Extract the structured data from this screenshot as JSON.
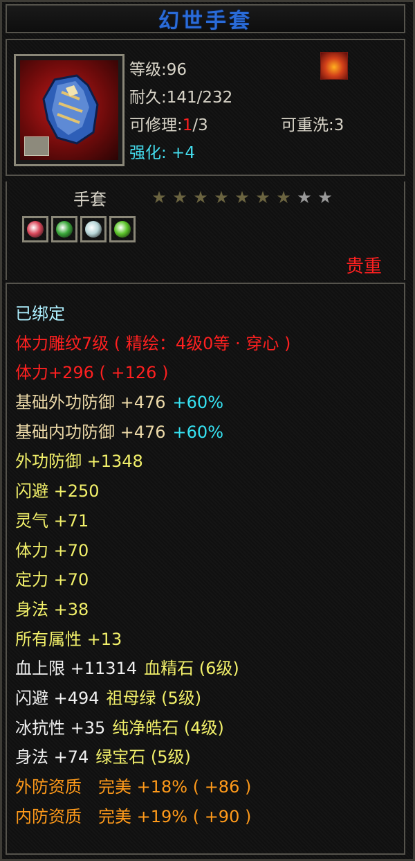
{
  "item": {
    "name": "幻世手套",
    "level_text": "等级:96",
    "durability_text": "耐久:141/232",
    "repair_prefix": "可修理:",
    "repair_current": "1",
    "repair_max": "/3",
    "rewash_text": "可重洗:3",
    "enhance_text": "强化: +4",
    "type": "手套",
    "stars_filled": 7,
    "stars_total": 9,
    "quality": "贵重"
  },
  "attributes": [
    {
      "text": "已绑定",
      "color": "#aef0ff"
    },
    {
      "text": "体力雕纹7级 ( 精绘：4级0等 · 穿心 )",
      "color": "#ff2020"
    },
    {
      "text": "体力+296 ( +126 )",
      "color": "#ff2020"
    },
    {
      "text": "基础外功防御 +476",
      "extra": "+60%",
      "color": "#ecd9a8",
      "extra_color": "#35e2f2"
    },
    {
      "text": "基础内功防御 +476",
      "extra": "+60%",
      "color": "#ecd9a8",
      "extra_color": "#35e2f2"
    },
    {
      "text": "外功防御 +1348",
      "color": "#f2f06a"
    },
    {
      "text": "闪避 +250",
      "color": "#f2f06a"
    },
    {
      "text": "灵气 +71",
      "color": "#f2f06a"
    },
    {
      "text": "体力 +70",
      "color": "#f2f06a"
    },
    {
      "text": "定力 +70",
      "color": "#f2f06a"
    },
    {
      "text": "身法 +38",
      "color": "#f2f06a"
    },
    {
      "text": "所有属性 +13",
      "color": "#f2f06a"
    },
    {
      "text": "血上限 +11314",
      "extra": "血精石 (6级)",
      "color": "#f0f0f0",
      "extra_color": "#f2f06a"
    },
    {
      "text": "闪避 +494",
      "extra": "祖母绿 (5级)",
      "color": "#f0f0f0",
      "extra_color": "#f2f06a"
    },
    {
      "text": "冰抗性 +35",
      "extra": "纯净皓石 (4级)",
      "color": "#f0f0f0",
      "extra_color": "#f2f06a"
    },
    {
      "text": "身法 +74",
      "extra": "绿宝石 (5级)",
      "color": "#f0f0f0",
      "extra_color": "#f2f06a"
    },
    {
      "text": "外防资质　完美 +18% ( +86 )",
      "color": "#ff9a1a"
    },
    {
      "text": "内防资质　完美 +19% ( +90 )",
      "color": "#ff9a1a"
    }
  ],
  "gems": [
    {
      "name": "red-gem-icon",
      "color": "#d9475a"
    },
    {
      "name": "green-gem-icon",
      "color": "#3aa83a"
    },
    {
      "name": "white-gem-icon",
      "color": "#b8d6d8"
    },
    {
      "name": "emerald-gem-icon",
      "color": "#5cc42a"
    }
  ]
}
